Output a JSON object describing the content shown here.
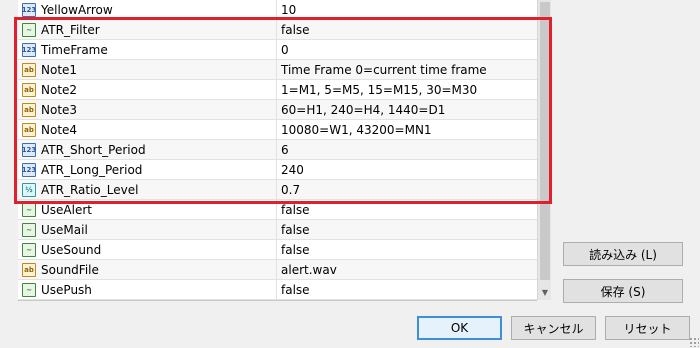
{
  "params": [
    {
      "name": "YellowArrow",
      "value": "10",
      "type": "int",
      "type_icon": "123"
    },
    {
      "name": "ATR_Filter",
      "value": "false",
      "type": "bool",
      "type_icon": "~"
    },
    {
      "name": "TimeFrame",
      "value": "0",
      "type": "int",
      "type_icon": "123"
    },
    {
      "name": "Note1",
      "value": "Time Frame 0=current time frame",
      "type": "str",
      "type_icon": "ab"
    },
    {
      "name": "Note2",
      "value": "1=M1, 5=M5, 15=M15, 30=M30",
      "type": "str",
      "type_icon": "ab"
    },
    {
      "name": "Note3",
      "value": "60=H1, 240=H4, 1440=D1",
      "type": "str",
      "type_icon": "ab"
    },
    {
      "name": "Note4",
      "value": "10080=W1, 43200=MN1",
      "type": "str",
      "type_icon": "ab"
    },
    {
      "name": "ATR_Short_Period",
      "value": "6",
      "type": "int",
      "type_icon": "123"
    },
    {
      "name": "ATR_Long_Period",
      "value": "240",
      "type": "int",
      "type_icon": "123"
    },
    {
      "name": "ATR_Ratio_Level",
      "value": "0.7",
      "type": "dbl",
      "type_icon": "½"
    },
    {
      "name": "UseAlert",
      "value": "false",
      "type": "bool",
      "type_icon": "~"
    },
    {
      "name": "UseMail",
      "value": "false",
      "type": "bool",
      "type_icon": "~"
    },
    {
      "name": "UseSound",
      "value": "false",
      "type": "bool",
      "type_icon": "~"
    },
    {
      "name": "SoundFile",
      "value": "alert.wav",
      "type": "str",
      "type_icon": "ab"
    },
    {
      "name": "UsePush",
      "value": "false",
      "type": "bool",
      "type_icon": "~"
    }
  ],
  "buttons": {
    "load": "読み込み (L)",
    "save": "保存 (S)",
    "ok": "OK",
    "cancel": "キャンセル",
    "reset": "リセット"
  },
  "highlight_color": "#e0202c"
}
